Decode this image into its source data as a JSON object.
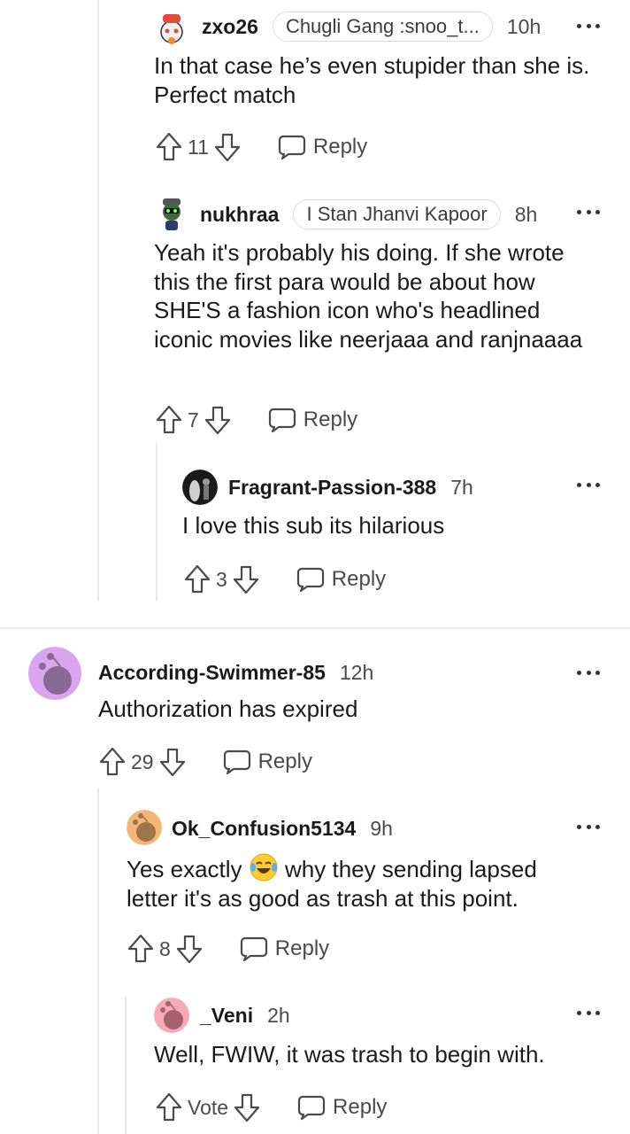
{
  "comments": [
    {
      "username": "zxo26",
      "flair": "Chugli Gang :snoo_t...",
      "time": "10h",
      "body": "In that case he’s even stupider than she is. Perfect match",
      "votes": "11",
      "reply_label": "Reply"
    },
    {
      "username": "nukhraa",
      "flair": "I Stan Jhanvi Kapoor",
      "time": "8h",
      "body": "Yeah it's probably his doing. If she wrote this the first para would be about how SHE'S a fashion icon who's headlined iconic movies like neerjaaa and ranjnaaaa",
      "votes": "7",
      "reply_label": "Reply"
    },
    {
      "username": "Fragrant-Passion-388",
      "time": "7h",
      "body": "I love this sub its hilarious",
      "votes": "3",
      "reply_label": "Reply"
    },
    {
      "username": "According-Swimmer-85",
      "time": "12h",
      "body": "Authorization has expired",
      "votes": "29",
      "reply_label": "Reply"
    },
    {
      "username": "Ok_Confusion5134",
      "time": "9h",
      "body_before": "Yes exactly",
      "body_after": "why they sending lapsed letter it's as good as trash at this point.",
      "votes": "8",
      "reply_label": "Reply"
    },
    {
      "username": "_Veni",
      "time": "2h",
      "body": "Well, FWIW, it was trash to begin with.",
      "votes": "Vote",
      "reply_label": "Reply"
    }
  ],
  "icons": {
    "upvote": "arrow-up-outline-icon",
    "downvote": "arrow-down-outline-icon",
    "reply": "speech-bubble-icon",
    "more": "ellipsis-icon",
    "emoji": "face-with-tears-of-joy"
  },
  "colors": {
    "text": "#1a1a1b",
    "muted": "#4a4a4a",
    "thread_line": "#e8e8e8",
    "snoo_purple": "#d8a5ee",
    "snoo_orange": "#f2b679",
    "snoo_pink": "#f6a9b8"
  }
}
